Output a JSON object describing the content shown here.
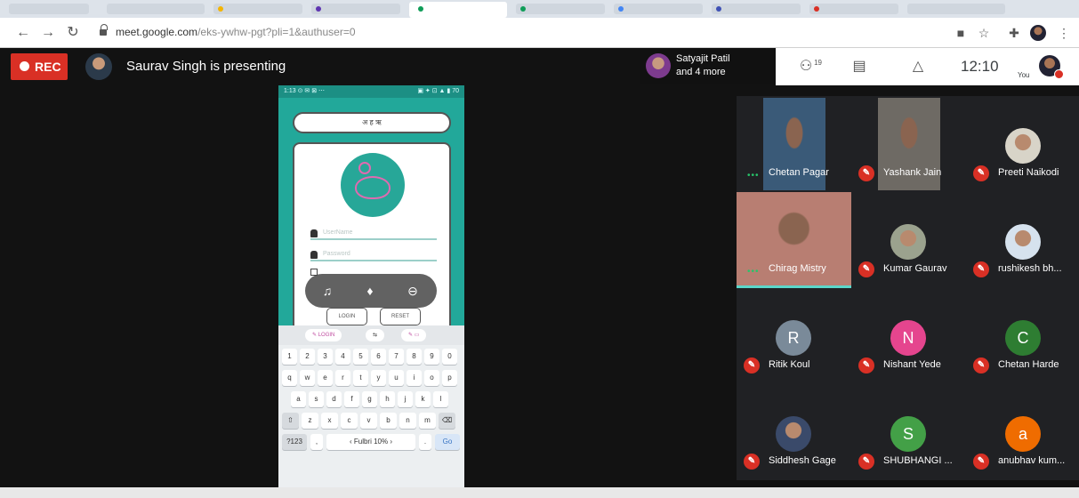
{
  "browser": {
    "url": "meet.google.com/eks-ywhw-pgt?pli=1&authuser=0",
    "url_host": "meet.google.com",
    "url_rest": "/eks-ywhw-pgt?pli=1&authuser=0"
  },
  "meet": {
    "rec_label": "REC",
    "presenting_text": "Saurav Singh is presenting",
    "others": {
      "name": "Satyajit Patil",
      "more": "and 4 more"
    },
    "people_count": "19",
    "clock": "12:10",
    "you_label": "You"
  },
  "phone": {
    "status_left": "1:13 ⊙ ✉ ⊠ ⋯",
    "status_right": "▣ ✦ ⊡ ▲ ▮ 70",
    "login_label": "अ ह ऋ",
    "username_placeholder": "UserName",
    "password_placeholder": "Password",
    "btn1": "LOGIN",
    "btn2": "RESET",
    "suggest_left": "✎ LOGIN",
    "suggest_mid": "⇆",
    "suggest_right": "✎ ▭",
    "keys_row1": [
      "1",
      "2",
      "3",
      "4",
      "5",
      "6",
      "7",
      "8",
      "9",
      "0"
    ],
    "keys_row2": [
      "q",
      "w",
      "e",
      "r",
      "t",
      "y",
      "u",
      "i",
      "o",
      "p"
    ],
    "keys_row3": [
      "a",
      "s",
      "d",
      "f",
      "g",
      "h",
      "j",
      "k",
      "l"
    ],
    "keys_row4": [
      "⇧",
      "z",
      "x",
      "c",
      "v",
      "b",
      "n",
      "m",
      "⌫"
    ],
    "key_sym": "?123",
    "key_comma": ",",
    "key_space": "‹ Fulbri 10% ›",
    "key_period": ".",
    "key_go": "Go"
  },
  "participants": [
    {
      "name": "Chetan Pagar",
      "kind": "video",
      "muted": false,
      "bg": "#3a5a78"
    },
    {
      "name": "Yashank Jain",
      "kind": "video",
      "muted": true,
      "bg": "#6e6a64"
    },
    {
      "name": "Preeti Naikodi",
      "kind": "photo",
      "muted": true,
      "color": "#d8d4c8"
    },
    {
      "name": "Chirag Mistry",
      "kind": "video",
      "muted": false,
      "bg": "#b87e72"
    },
    {
      "name": "Kumar Gaurav",
      "kind": "photo",
      "muted": true,
      "color": "#9ba28e"
    },
    {
      "name": "rushikesh bh...",
      "kind": "photo",
      "muted": true,
      "color": "#d6e2ee"
    },
    {
      "name": "Ritik Koul",
      "kind": "letter",
      "letter": "R",
      "muted": true,
      "color": "#7a8a99"
    },
    {
      "name": "Nishant Yede",
      "kind": "letter",
      "letter": "N",
      "muted": true,
      "color": "#e5458e"
    },
    {
      "name": "Chetan Harde",
      "kind": "letter",
      "letter": "C",
      "muted": true,
      "color": "#2e7d32"
    },
    {
      "name": "Siddhesh Gage",
      "kind": "photo",
      "muted": true,
      "color": "#3a4a6a"
    },
    {
      "name": "SHUBHANGI ...",
      "kind": "letter",
      "letter": "S",
      "muted": true,
      "color": "#43a047"
    },
    {
      "name": "anubhav kum...",
      "kind": "letter",
      "letter": "a",
      "muted": true,
      "color": "#ef6c00"
    }
  ],
  "colors": {
    "rec": "#d93025",
    "teal": "#22a89a",
    "tile": "#202124"
  }
}
